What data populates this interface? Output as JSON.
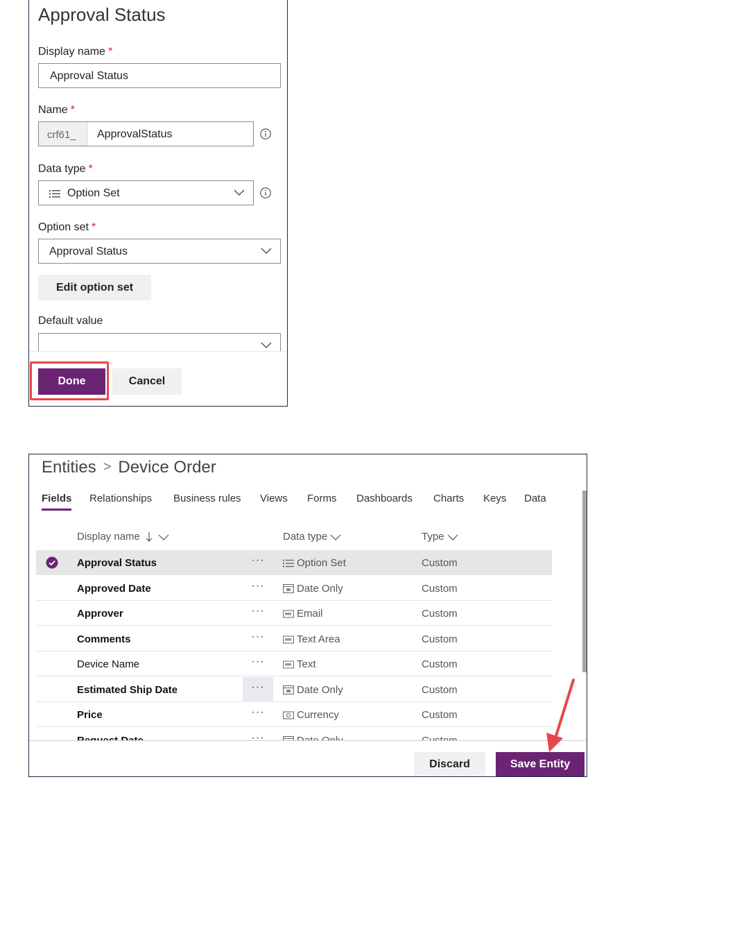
{
  "field_editor": {
    "title": "Approval Status",
    "display_name": {
      "label": "Display name",
      "required": "*",
      "value": "Approval Status"
    },
    "name": {
      "label": "Name",
      "required": "*",
      "prefix": "crf61_",
      "value": "ApprovalStatus"
    },
    "data_type": {
      "label": "Data type",
      "required": "*",
      "value": "Option Set"
    },
    "option_set": {
      "label": "Option set",
      "required": "*",
      "value": "Approval Status"
    },
    "edit_option_set_label": "Edit option set",
    "default_value": {
      "label": "Default value",
      "value": ""
    },
    "done_label": "Done",
    "cancel_label": "Cancel"
  },
  "entity_view": {
    "breadcrumb": {
      "root": "Entities",
      "separator": ">",
      "current": "Device Order"
    },
    "tabs": [
      "Fields",
      "Relationships",
      "Business rules",
      "Views",
      "Forms",
      "Dashboards",
      "Charts",
      "Keys",
      "Data"
    ],
    "active_tab": "Fields",
    "columns": {
      "display_name": "Display name",
      "data_type": "Data type",
      "type": "Type"
    },
    "rows": [
      {
        "name": "Approval Status",
        "bold": true,
        "selected": true,
        "more": "···",
        "icon": "list-icon",
        "data_type": "Option Set",
        "type": "Custom"
      },
      {
        "name": "Approved Date",
        "bold": true,
        "selected": false,
        "more": "···",
        "icon": "calendar-icon",
        "data_type": "Date Only",
        "type": "Custom"
      },
      {
        "name": "Approver",
        "bold": true,
        "selected": false,
        "more": "···",
        "icon": "text-field-icon",
        "data_type": "Email",
        "type": "Custom"
      },
      {
        "name": "Comments",
        "bold": true,
        "selected": false,
        "more": "···",
        "icon": "text-field-icon",
        "data_type": "Text Area",
        "type": "Custom"
      },
      {
        "name": "Device Name",
        "bold": false,
        "selected": false,
        "more": "···",
        "icon": "text-field-icon",
        "data_type": "Text",
        "type": "Custom"
      },
      {
        "name": "Estimated Ship Date",
        "bold": true,
        "selected": false,
        "more": "···",
        "icon": "calendar-icon",
        "data_type": "Date Only",
        "type": "Custom"
      },
      {
        "name": "Price",
        "bold": true,
        "selected": false,
        "more": "···",
        "icon": "currency-icon",
        "data_type": "Currency",
        "type": "Custom"
      },
      {
        "name": "Request Date",
        "bold": true,
        "selected": false,
        "more": "···",
        "icon": "calendar-icon",
        "data_type": "Date Only",
        "type": "Custom"
      }
    ],
    "discard_label": "Discard",
    "save_label": "Save Entity"
  },
  "colors": {
    "accent": "#6b2473",
    "highlight": "#e8474a",
    "required": "#c4262e"
  }
}
